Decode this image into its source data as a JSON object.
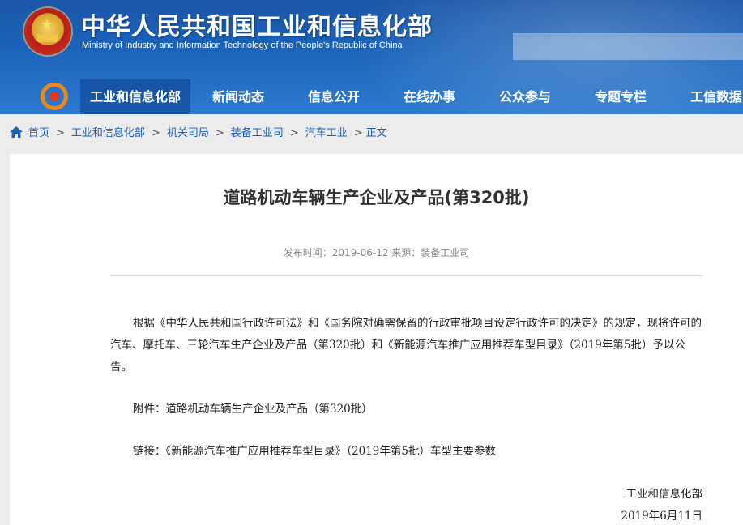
{
  "header": {
    "title": "中华人民共和国工业和信息化部",
    "subtitle": "Ministry of Industry and Information Technology of the People's Republic of China"
  },
  "nav": {
    "items": [
      {
        "label": "工业和信息化部"
      },
      {
        "label": "新闻动态"
      },
      {
        "label": "信息公开"
      },
      {
        "label": "在线办事"
      },
      {
        "label": "公众参与"
      },
      {
        "label": "专题专栏"
      },
      {
        "label": "工信数据"
      }
    ]
  },
  "breadcrumb": {
    "items": [
      "首页",
      "工业和信息化部",
      "机关司局",
      "装备工业司",
      "汽车工业"
    ],
    "current": "正文",
    "separator": ">"
  },
  "article": {
    "title": "道路机动车辆生产企业及产品(第320批)",
    "meta": "发布时间：2019-06-12  来源：装备工业司",
    "para1": "根据《中华人民共和国行政许可法》和《国务院对确需保留的行政审批项目设定行政许可的决定》的规定，现将许可的汽车、摩托车、三轮汽车生产企业及产品（第320批）和《新能源汽车推广应用推荐车型目录》（2019年第5批）予以公告。",
    "attachment_prefix": "附件：",
    "attachment_link": "道路机动车辆生产企业及产品（第320批）",
    "link_prefix": "链接：",
    "link_text": "《新能源汽车推广应用推荐车型目录》（2019年第5批）车型主要参数",
    "sign_org": "工业和信息化部",
    "sign_date": "2019年6月11日"
  },
  "colors": {
    "header_blue": "#1a62b8",
    "link_blue": "#1d5fb4",
    "page_bg": "#ececec"
  }
}
